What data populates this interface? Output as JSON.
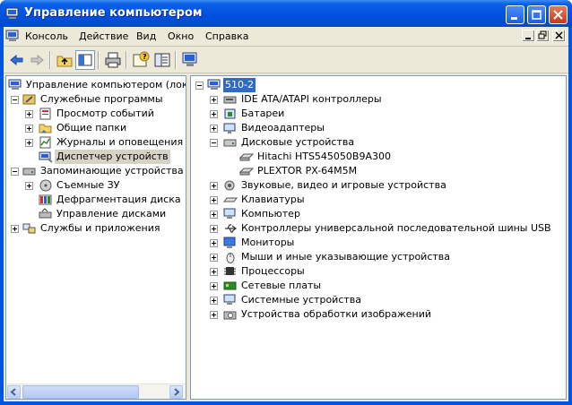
{
  "window": {
    "title": "Управление компьютером"
  },
  "menu": {
    "items": [
      "Консоль",
      "Действие",
      "Вид",
      "Окно",
      "Справка"
    ]
  },
  "toolbar": {
    "buttons": [
      "back-arrow-icon",
      "forward-arrow-icon",
      "up-folder-icon",
      "show-hide-tree-icon",
      "print-icon",
      "help-icon",
      "export-list-icon",
      "properties-icon"
    ]
  },
  "left_tree": {
    "root": "Управление компьютером (локаль",
    "nodes": [
      "Служебные программы",
      "Просмотр событий",
      "Общие папки",
      "Журналы и оповещения пр",
      "Диспетчер устройств",
      "Запоминающие устройства",
      "Съемные ЗУ",
      "Дефрагментация диска",
      "Управление дисками",
      "Службы и приложения"
    ]
  },
  "right_tree": {
    "root": "510-2",
    "items": [
      "IDE ATA/ATAPI контроллеры",
      "Батареи",
      "Видеоадаптеры",
      "Дисковые устройства",
      "Hitachi HTS545050B9A300",
      "PLEXTOR PX-64M5M",
      "Звуковые, видео и игровые устройства",
      "Клавиатуры",
      "Компьютер",
      "Контроллеры универсальной последовательной шины USB",
      "Мониторы",
      "Мыши и иные указывающие устройства",
      "Процессоры",
      "Сетевые платы",
      "Системные устройства",
      "Устройства обработки изображений"
    ]
  },
  "colors": {
    "title_bar": "#0054e3",
    "selection": "#316ac5",
    "face": "#ece9d8"
  }
}
